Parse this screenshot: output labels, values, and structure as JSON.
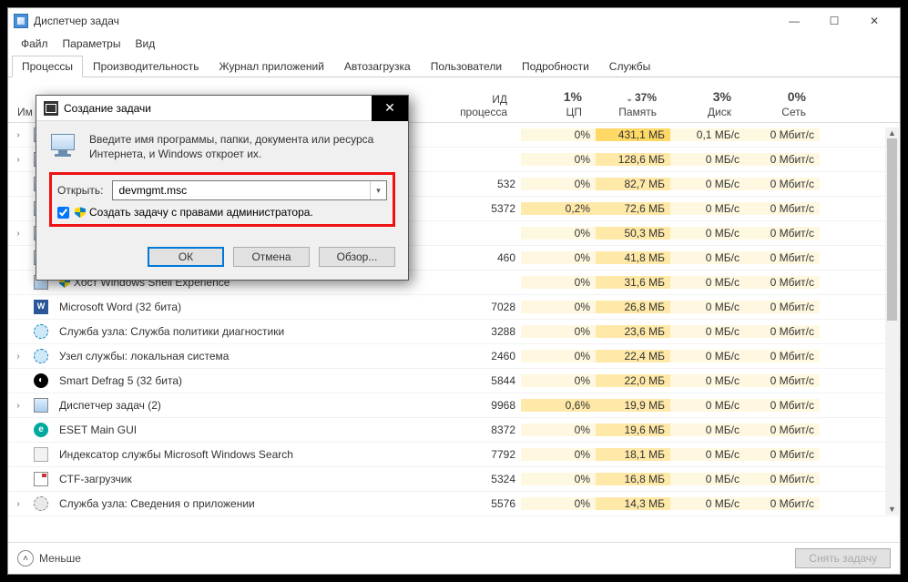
{
  "window": {
    "title": "Диспетчер задач",
    "menu": [
      "Файл",
      "Параметры",
      "Вид"
    ],
    "tabs": [
      "Процессы",
      "Производительность",
      "Журнал приложений",
      "Автозагрузка",
      "Пользователи",
      "Подробности",
      "Службы"
    ],
    "active_tab": 0
  },
  "columns": {
    "name": "Им",
    "pid": "ИД процесса",
    "cpu": {
      "pct": "1%",
      "label": "ЦП"
    },
    "mem": {
      "pct": "37%",
      "label": "Память",
      "sorted": true
    },
    "disk": {
      "pct": "3%",
      "label": "Диск"
    },
    "net": {
      "pct": "0%",
      "label": "Сеть"
    }
  },
  "rows": [
    {
      "expand": true,
      "icon": "app",
      "name": "",
      "pid": "",
      "cpu": "0%",
      "mem": "431,1 МБ",
      "disk": "0,1 МБ/с",
      "net": "0 Мбит/с",
      "memhi": true
    },
    {
      "expand": true,
      "icon": "app",
      "name": "",
      "pid": "",
      "cpu": "0%",
      "mem": "128,6 МБ",
      "disk": "0 МБ/с",
      "net": "0 Мбит/с"
    },
    {
      "expand": false,
      "icon": "app",
      "name": "",
      "pid": "532",
      "cpu": "0%",
      "mem": "82,7 МБ",
      "disk": "0 МБ/с",
      "net": "0 Мбит/с"
    },
    {
      "expand": false,
      "icon": "app",
      "name": "",
      "pid": "5372",
      "cpu": "0,2%",
      "mem": "72,6 МБ",
      "disk": "0 МБ/с",
      "net": "0 Мбит/с",
      "cpuhi": true
    },
    {
      "expand": true,
      "icon": "app",
      "name": "",
      "pid": "",
      "cpu": "0%",
      "mem": "50,3 МБ",
      "disk": "0 МБ/с",
      "net": "0 Мбит/с"
    },
    {
      "expand": false,
      "icon": "app",
      "name": "",
      "pid": "460",
      "cpu": "0%",
      "mem": "41,8 МБ",
      "disk": "0 МБ/с",
      "net": "0 Мбит/с"
    },
    {
      "expand": false,
      "icon": "app",
      "name": "Хост Windows Shell Experience",
      "pid": "",
      "cpu": "0%",
      "mem": "31,6 МБ",
      "disk": "0 МБ/с",
      "net": "0 Мбит/с",
      "leaf": true
    },
    {
      "expand": false,
      "icon": "word",
      "name": "Microsoft Word (32 бита)",
      "pid": "7028",
      "cpu": "0%",
      "mem": "26,8 МБ",
      "disk": "0 МБ/с",
      "net": "0 Мбит/с"
    },
    {
      "expand": false,
      "icon": "gear",
      "name": "Служба узла: Служба политики диагностики",
      "pid": "3288",
      "cpu": "0%",
      "mem": "23,6 МБ",
      "disk": "0 МБ/с",
      "net": "0 Мбит/с"
    },
    {
      "expand": true,
      "icon": "gear",
      "name": "Узел службы: локальная система",
      "pid": "2460",
      "cpu": "0%",
      "mem": "22,4 МБ",
      "disk": "0 МБ/с",
      "net": "0 Мбит/с"
    },
    {
      "expand": false,
      "icon": "defrag",
      "name": "Smart Defrag 5 (32 бита)",
      "pid": "5844",
      "cpu": "0%",
      "mem": "22,0 МБ",
      "disk": "0 МБ/с",
      "net": "0 Мбит/с"
    },
    {
      "expand": true,
      "icon": "app",
      "name": "Диспетчер задач (2)",
      "pid": "9968",
      "cpu": "0,6%",
      "mem": "19,9 МБ",
      "disk": "0 МБ/с",
      "net": "0 Мбит/с",
      "cpuhi": true
    },
    {
      "expand": false,
      "icon": "eset",
      "name": "ESET Main GUI",
      "pid": "8372",
      "cpu": "0%",
      "mem": "19,6 МБ",
      "disk": "0 МБ/с",
      "net": "0 Мбит/с"
    },
    {
      "expand": false,
      "icon": "search",
      "name": "Индексатор службы Microsoft Windows Search",
      "pid": "7792",
      "cpu": "0%",
      "mem": "18,1 МБ",
      "disk": "0 МБ/с",
      "net": "0 Мбит/с"
    },
    {
      "expand": false,
      "icon": "ctf",
      "name": "CTF-загрузчик",
      "pid": "5324",
      "cpu": "0%",
      "mem": "16,8 МБ",
      "disk": "0 МБ/с",
      "net": "0 Мбит/с"
    },
    {
      "expand": true,
      "icon": "gear2",
      "name": "Служба узла: Сведения о приложении",
      "pid": "5576",
      "cpu": "0%",
      "mem": "14,3 МБ",
      "disk": "0 МБ/с",
      "net": "0 Мбит/с"
    }
  ],
  "footer": {
    "less": "Меньше",
    "end_task": "Снять задачу"
  },
  "modal": {
    "title": "Создание задачи",
    "description": "Введите имя программы, папки, документа или ресурса Интернета, и Windows откроет их.",
    "open_label": "Открыть:",
    "input_value": "devmgmt.msc",
    "admin_checkbox": "Создать задачу с правами администратора.",
    "buttons": {
      "ok": "ОК",
      "cancel": "Отмена",
      "browse": "Обзор..."
    }
  }
}
